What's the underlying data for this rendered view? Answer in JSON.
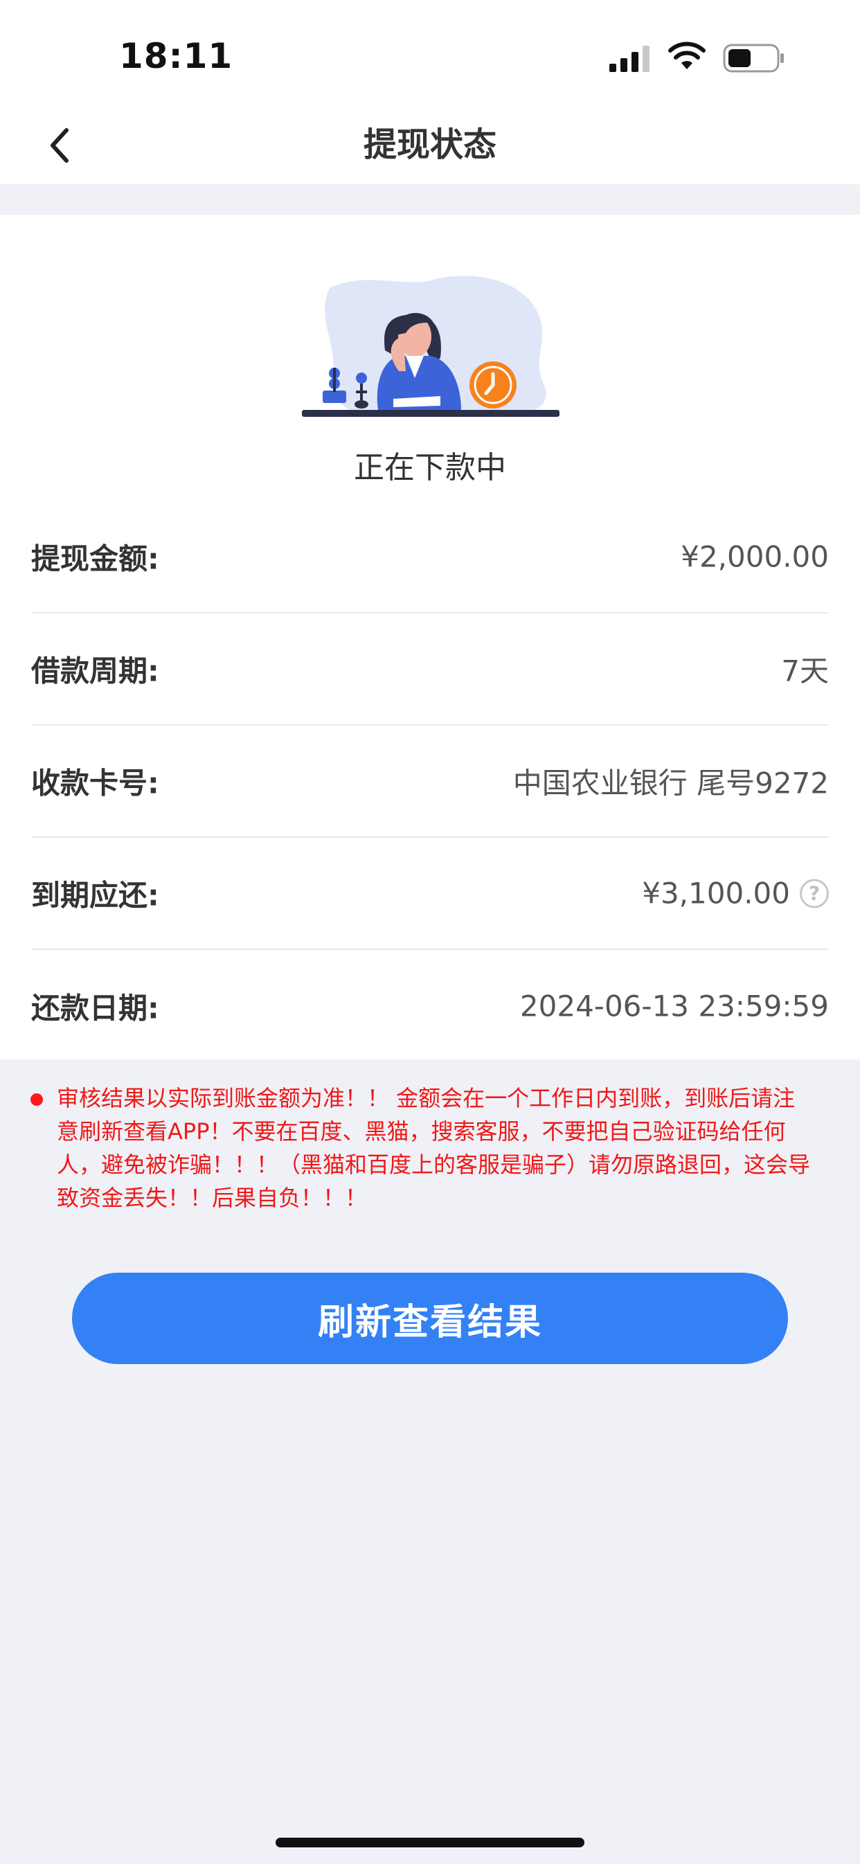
{
  "status_bar": {
    "time": "18:11"
  },
  "nav": {
    "title": "提现状态"
  },
  "card": {
    "status_text": "正在下款中",
    "rows": [
      {
        "label": "提现金额:",
        "value": "¥2,000.00"
      },
      {
        "label": "借款周期:",
        "value": "7天"
      },
      {
        "label": "收款卡号:",
        "value": "中国农业银行 尾号9272"
      },
      {
        "label": "到期应还:",
        "value": "¥3,100.00",
        "help_icon": "?"
      },
      {
        "label": "还款日期:",
        "value": "2024-06-13 23:59:59"
      }
    ]
  },
  "notice": {
    "text": "审核结果以实际到账金额为准！！ 金额会在一个工作日内到账，到账后请注意刷新查看APP！不要在百度、黑猫，搜索客服，不要把自己验证码给任何人，避免被诈骗！！！（黑猫和百度上的客服是骗子）请勿原路退回，这会导致资金丢失！！后果自负！！！",
    "color": "#f01818"
  },
  "actions": {
    "refresh_label": "刷新查看结果"
  },
  "colors": {
    "accent": "#3381f5",
    "background": "#eff1f6",
    "orange": "#f7821b"
  }
}
